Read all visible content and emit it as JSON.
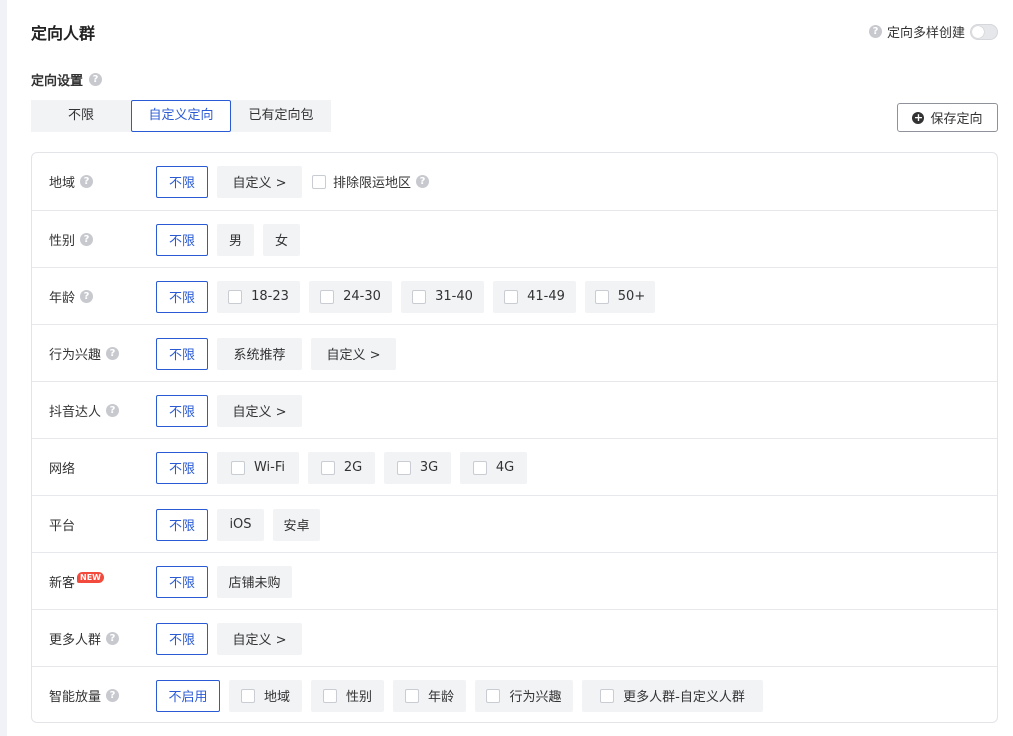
{
  "header": {
    "title": "定向人群",
    "multi_create_label": "定向多样创建",
    "multi_create_enabled": false
  },
  "settings": {
    "label": "定向设置",
    "tabs": [
      {
        "label": "不限",
        "active": false
      },
      {
        "label": "自定义定向",
        "active": true
      },
      {
        "label": "已有定向包",
        "active": false
      }
    ],
    "save_label": "保存定向"
  },
  "colors": {
    "accent": "#2b5bd4",
    "badge": "#f24b3d",
    "chip_bg": "#f2f3f5"
  },
  "rows": [
    {
      "label": "地域",
      "help": true,
      "unlimited": "不限",
      "custom": "自定义 >",
      "exclude": "排除限运地区"
    },
    {
      "label": "性别",
      "help": true,
      "unlimited": "不限",
      "options": [
        "男",
        "女"
      ]
    },
    {
      "label": "年龄",
      "help": true,
      "unlimited": "不限",
      "options": [
        "18-23",
        "24-30",
        "31-40",
        "41-49",
        "50+"
      ]
    },
    {
      "label": "行为兴趣",
      "help": true,
      "unlimited": "不限",
      "options": [
        "系统推荐",
        "自定义 >"
      ]
    },
    {
      "label": "抖音达人",
      "help": true,
      "unlimited": "不限",
      "options": [
        "自定义 >"
      ]
    },
    {
      "label": "网络",
      "help": false,
      "unlimited": "不限",
      "options": [
        "Wi-Fi",
        "2G",
        "3G",
        "4G"
      ]
    },
    {
      "label": "平台",
      "help": false,
      "unlimited": "不限",
      "options": [
        "iOS",
        "安卓"
      ]
    },
    {
      "label": "新客",
      "badge": "NEW",
      "unlimited": "不限",
      "options": [
        "店铺未购"
      ]
    },
    {
      "label": "更多人群",
      "help": true,
      "unlimited": "不限",
      "options": [
        "自定义 >"
      ]
    },
    {
      "label": "智能放量",
      "help": true,
      "unlimited": "不启用",
      "options": [
        "地域",
        "性别",
        "年龄",
        "行为兴趣",
        "更多人群-自定义人群"
      ]
    }
  ]
}
